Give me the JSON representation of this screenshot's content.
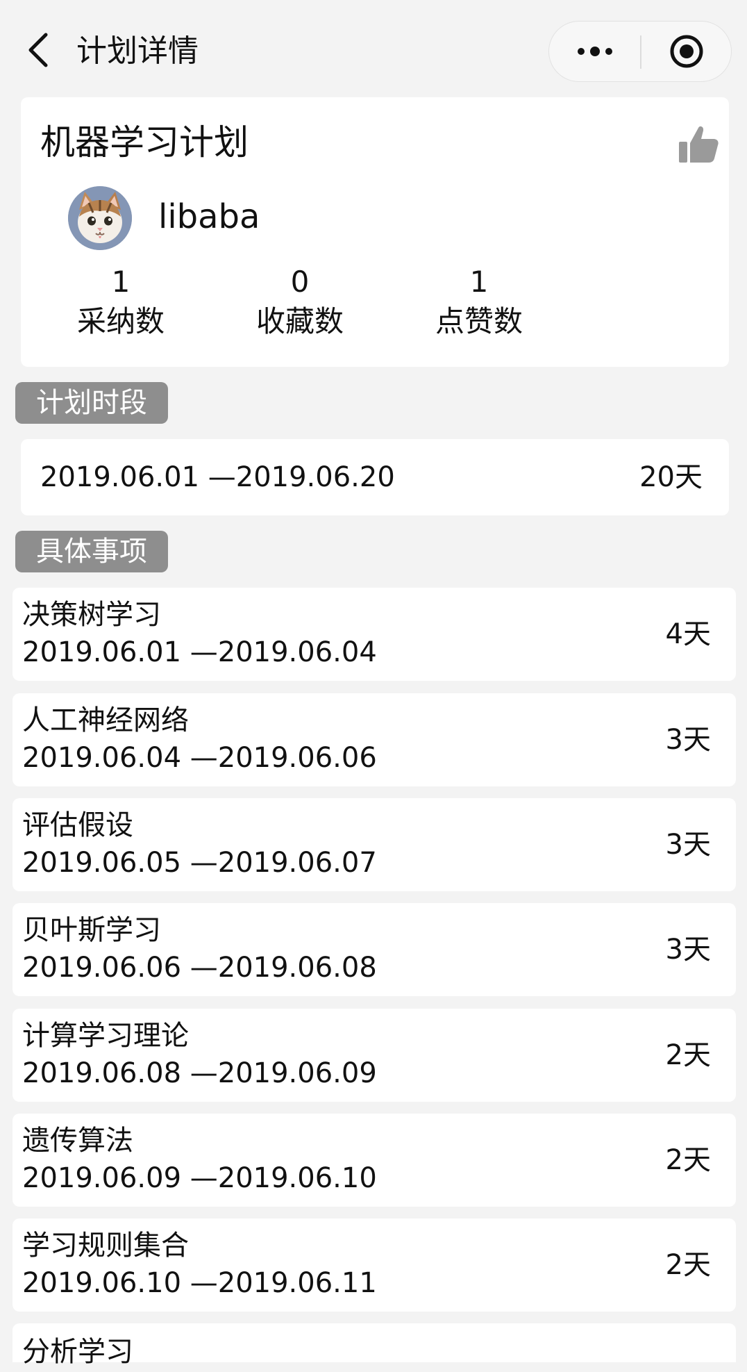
{
  "header": {
    "title": "计划详情",
    "back_icon": "chevron-left-icon",
    "more_icon": "more-dots-icon",
    "target_icon": "target-circle-icon"
  },
  "plan": {
    "title": "机器学习计划",
    "like_icon": "thumbs-up-icon",
    "author": {
      "name": "libaba",
      "avatar": "cat-avatar"
    },
    "stats": [
      {
        "value": "1",
        "label": "采纳数"
      },
      {
        "value": "0",
        "label": "收藏数"
      },
      {
        "value": "1",
        "label": "点赞数"
      }
    ]
  },
  "period_section": {
    "tag": "计划时段",
    "range": "2019.06.01 —2019.06.20",
    "days": "20天"
  },
  "items_section": {
    "tag": "具体事项",
    "items": [
      {
        "name": "决策树学习",
        "range": "2019.06.01 —2019.06.04",
        "days": "4天"
      },
      {
        "name": "人工神经网络",
        "range": "2019.06.04 —2019.06.06",
        "days": "3天"
      },
      {
        "name": "评估假设",
        "range": "2019.06.05 —2019.06.07",
        "days": "3天"
      },
      {
        "name": "贝叶斯学习",
        "range": "2019.06.06 —2019.06.08",
        "days": "3天"
      },
      {
        "name": "计算学习理论",
        "range": "2019.06.08 —2019.06.09",
        "days": "2天"
      },
      {
        "name": "遗传算法",
        "range": "2019.06.09 —2019.06.10",
        "days": "2天"
      },
      {
        "name": "学习规则集合",
        "range": "2019.06.10 —2019.06.11",
        "days": "2天"
      },
      {
        "name": "分析学习",
        "range": "",
        "days": ""
      }
    ]
  },
  "colors": {
    "background": "#f3f3f3",
    "card": "#ffffff",
    "tag": "#8e8e8e",
    "icon_gray": "#9a9a9a",
    "text": "#111111"
  }
}
